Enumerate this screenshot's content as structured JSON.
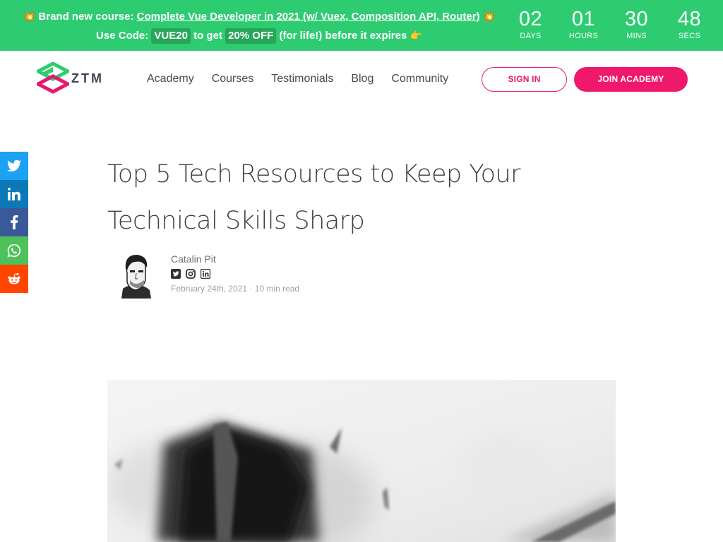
{
  "promo": {
    "prefix": "Brand new course:",
    "course_link": "Complete Vue Developer in 2021 (w/ Vuex, Composition API, Router)",
    "code_prefix": "Use Code:",
    "code": "VUE20",
    "to_get": "to get",
    "discount": "20% OFF",
    "suffix": "(for life!) before it expires",
    "icons": [
      "collision-icon",
      "pointing-hand-icon"
    ]
  },
  "countdown": [
    {
      "value": "02",
      "label": "DAYS"
    },
    {
      "value": "01",
      "label": "HOURS"
    },
    {
      "value": "30",
      "label": "MINS"
    },
    {
      "value": "48",
      "label": "SECS"
    }
  ],
  "header": {
    "logo_text": "ZTM",
    "nav": [
      "Academy",
      "Courses",
      "Testimonials",
      "Blog",
      "Community"
    ],
    "sign_in": "SIGN IN",
    "join": "JOIN ACADEMY"
  },
  "share": [
    "twitter-icon",
    "linkedin-icon",
    "facebook-icon",
    "whatsapp-icon",
    "reddit-icon"
  ],
  "article": {
    "title": "Top 5 Tech Resources to Keep Your Technical Skills Sharp",
    "author": "Catalin Pit",
    "author_socials": [
      "twitter-icon",
      "instagram-icon",
      "linkedin-icon"
    ],
    "meta": "February 24th, 2021 · 10 min read"
  },
  "colors": {
    "banner_green": "#2ecc71",
    "chip_green": "#27a558",
    "brand_pink": "#f0186b",
    "title_text": "#3a3f45"
  }
}
